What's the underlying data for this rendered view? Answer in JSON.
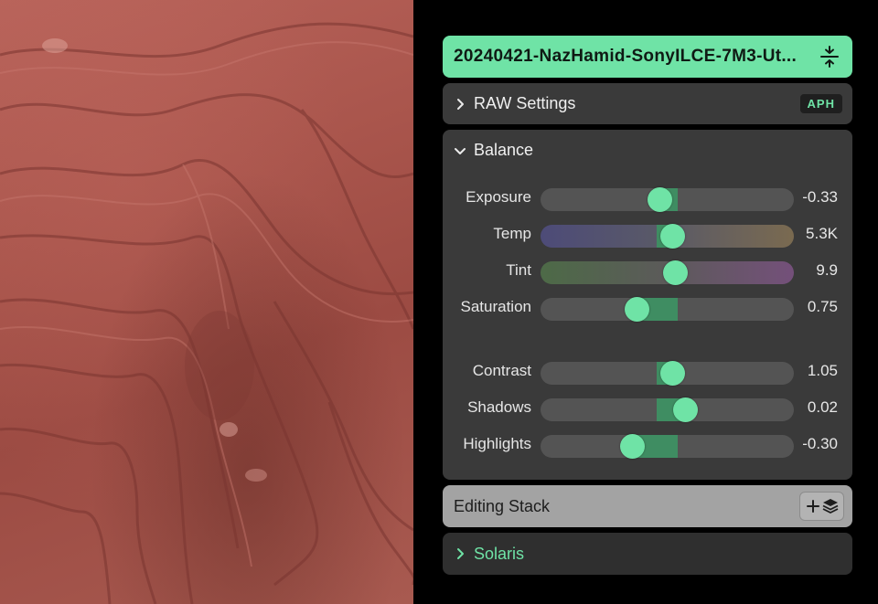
{
  "header": {
    "filename": "20240421-NazHamid-SonyILCE-7M3-Ut..."
  },
  "raw_settings": {
    "title": "RAW Settings",
    "badge": "APH"
  },
  "balance": {
    "title": "Balance",
    "sliders": [
      {
        "label": "Exposure",
        "value": "-0.33",
        "level": 0.47,
        "fill_from": 0.47,
        "fill_to": 0.54
      },
      {
        "label": "Temp",
        "value": "5.3K",
        "level": 0.52,
        "fill_from": 0.46,
        "fill_to": 0.52
      },
      {
        "label": "Tint",
        "value": "9.9",
        "level": 0.53,
        "fill_from": 0.53,
        "fill_to": 0.53
      },
      {
        "label": "Saturation",
        "value": "0.75",
        "level": 0.38,
        "fill_from": 0.38,
        "fill_to": 0.54
      },
      {
        "label": "Contrast",
        "value": "1.05",
        "level": 0.52,
        "fill_from": 0.46,
        "fill_to": 0.52
      },
      {
        "label": "Shadows",
        "value": "0.02",
        "level": 0.57,
        "fill_from": 0.46,
        "fill_to": 0.57
      },
      {
        "label": "Highlights",
        "value": "-0.30",
        "level": 0.36,
        "fill_from": 0.36,
        "fill_to": 0.54
      }
    ]
  },
  "editing_stack": {
    "title": "Editing Stack"
  },
  "solaris": {
    "title": "Solaris"
  },
  "colors": {
    "accent": "#6fe3a6",
    "fill": "#3f8d62",
    "track": "#545454",
    "panel": "#3a3a3a"
  }
}
